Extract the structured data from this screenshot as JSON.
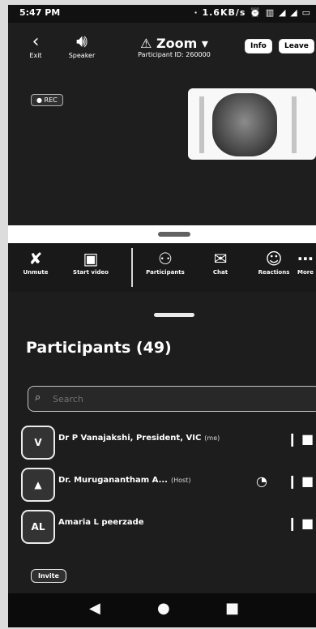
{
  "status_bar": {
    "time": "5:47 PM",
    "right": "· 1.6KB/s ⏰ ▥ ◢ ◢ ▭"
  },
  "top_bar": {
    "exit": {
      "icon": "exit-icon",
      "label": "Exit"
    },
    "speaker": {
      "icon": "speaker-icon",
      "label": "Speaker"
    },
    "title": "Zoom",
    "subtitle": "Participant ID: 260000",
    "info_button": "Info",
    "leave_button": "Leave"
  },
  "rec_badge": "● REC",
  "toolbar": [
    {
      "icon": "microphone-muted-icon",
      "label": "Unmute"
    },
    {
      "icon": "video-off-icon",
      "label": "Start video"
    },
    {
      "icon": "participants-icon",
      "label": "Participants"
    },
    {
      "icon": "chat-icon",
      "label": "Chat"
    },
    {
      "icon": "reactions-icon",
      "label": "Reactions"
    },
    {
      "icon": "more-icon",
      "label": "More"
    }
  ],
  "participants_panel": {
    "title": "Participants (49)",
    "search_placeholder": "Search"
  },
  "participants": [
    {
      "initial": "V",
      "name": "Dr P Vanajakshi, President, VIC",
      "tag": "(me)",
      "extra_icon": ""
    },
    {
      "initial": "",
      "name": "Dr. Muruganantham A...",
      "tag": "(Host)",
      "extra_icon": "◔"
    },
    {
      "initial": "AL",
      "name": "Amaria L peerzade",
      "tag": "",
      "extra_icon": ""
    }
  ],
  "invite_button": "Invite",
  "colors": {
    "background": "#2a2a2a",
    "text": "#f0f0f0"
  }
}
